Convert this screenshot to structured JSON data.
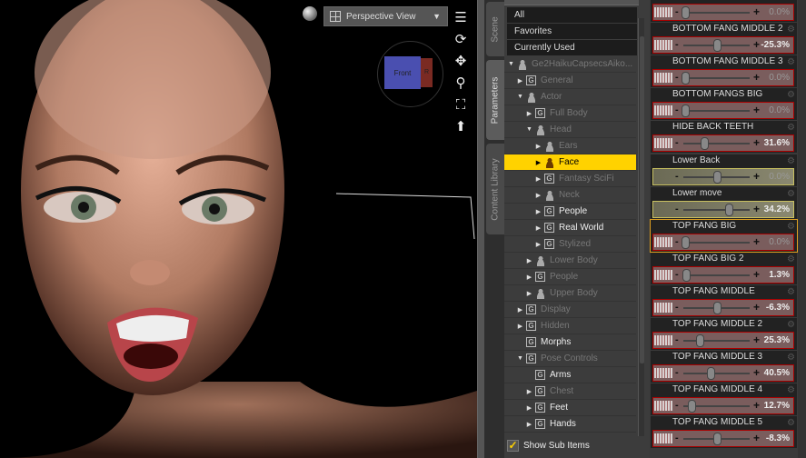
{
  "viewport": {
    "view_label": "Perspective View",
    "cube_front": "Front",
    "cube_side": "R",
    "tools": [
      "menu-icon",
      "orbit-icon",
      "pan-icon",
      "zoom-icon",
      "frame-icon",
      "reset-icon"
    ]
  },
  "side_tabs": [
    {
      "label": "Scene",
      "active": false
    },
    {
      "label": "Parameters",
      "active": true
    },
    {
      "label": "Content Library",
      "active": false
    }
  ],
  "tree": {
    "quick": [
      "All",
      "Favorites",
      "Currently Used"
    ],
    "items": [
      {
        "label": "Ge2HaikuCapsecsAiko...",
        "depth": 0,
        "icon": "figure",
        "exp": "open",
        "on": false
      },
      {
        "label": "General",
        "depth": 1,
        "icon": "group",
        "exp": "closed",
        "on": false
      },
      {
        "label": "Actor",
        "depth": 1,
        "icon": "person",
        "exp": "open",
        "on": false
      },
      {
        "label": "Full Body",
        "depth": 2,
        "icon": "group",
        "exp": "closed",
        "on": false
      },
      {
        "label": "Head",
        "depth": 2,
        "icon": "person",
        "exp": "open",
        "on": false
      },
      {
        "label": "Ears",
        "depth": 3,
        "icon": "person",
        "exp": "closed",
        "on": false
      },
      {
        "label": "Face",
        "depth": 3,
        "icon": "person",
        "exp": "closed",
        "on": true,
        "selected": true
      },
      {
        "label": "Fantasy SciFi",
        "depth": 3,
        "icon": "group",
        "exp": "closed",
        "on": false
      },
      {
        "label": "Neck",
        "depth": 3,
        "icon": "person",
        "exp": "closed",
        "on": false
      },
      {
        "label": "People",
        "depth": 3,
        "icon": "group",
        "exp": "closed",
        "on": true
      },
      {
        "label": "Real World",
        "depth": 3,
        "icon": "group",
        "exp": "closed",
        "on": true
      },
      {
        "label": "Stylized",
        "depth": 3,
        "icon": "group",
        "exp": "closed",
        "on": false
      },
      {
        "label": "Lower Body",
        "depth": 2,
        "icon": "person",
        "exp": "closed",
        "on": false
      },
      {
        "label": "People",
        "depth": 2,
        "icon": "group",
        "exp": "closed",
        "on": false
      },
      {
        "label": "Upper Body",
        "depth": 2,
        "icon": "person",
        "exp": "closed",
        "on": false
      },
      {
        "label": "Display",
        "depth": 1,
        "icon": "group",
        "exp": "closed",
        "on": false
      },
      {
        "label": "Hidden",
        "depth": 1,
        "icon": "group",
        "exp": "closed",
        "on": false
      },
      {
        "label": "Morphs",
        "depth": 1,
        "icon": "group",
        "exp": "none",
        "on": true
      },
      {
        "label": "Pose Controls",
        "depth": 1,
        "icon": "group",
        "exp": "open",
        "on": false
      },
      {
        "label": "Arms",
        "depth": 2,
        "icon": "group",
        "exp": "none",
        "on": true
      },
      {
        "label": "Chest",
        "depth": 2,
        "icon": "group",
        "exp": "closed",
        "on": false
      },
      {
        "label": "Feet",
        "depth": 2,
        "icon": "group",
        "exp": "closed",
        "on": true
      },
      {
        "label": "Hands",
        "depth": 2,
        "icon": "group",
        "exp": "closed",
        "on": true
      }
    ],
    "show_sub_items": {
      "label": "Show Sub Items",
      "checked": true
    }
  },
  "params": [
    {
      "name": "BOTTOM FANG MIDDLE",
      "value": "0.0%",
      "pos": 0.03,
      "style": "red"
    },
    {
      "name": "BOTTOM FANG MIDDLE 2",
      "value": "-25.3%",
      "pos": 0.5,
      "style": "red"
    },
    {
      "name": "BOTTOM FANG MIDDLE 3",
      "value": "0.0%",
      "pos": 0.03,
      "style": "red"
    },
    {
      "name": "BOTTOM FANGS BIG",
      "value": "0.0%",
      "pos": 0.03,
      "style": "red"
    },
    {
      "name": "HIDE BACK TEETH",
      "value": "31.6%",
      "pos": 0.32,
      "style": "red"
    },
    {
      "name": "Lower Back",
      "value": "0.0%",
      "pos": 0.5,
      "style": "yellow"
    },
    {
      "name": "Lower move",
      "value": "34.2%",
      "pos": 0.68,
      "style": "yellow"
    },
    {
      "name": "TOP FANG BIG",
      "value": "0.0%",
      "pos": 0.03,
      "style": "red",
      "highlighted": true
    },
    {
      "name": "TOP FANG BIG 2",
      "value": "1.3%",
      "pos": 0.04,
      "style": "red"
    },
    {
      "name": "TOP FANG MIDDLE",
      "value": "-6.3%",
      "pos": 0.5,
      "style": "red"
    },
    {
      "name": "TOP FANG MIDDLE 2",
      "value": "25.3%",
      "pos": 0.25,
      "style": "red"
    },
    {
      "name": "TOP FANG MIDDLE 3",
      "value": "40.5%",
      "pos": 0.41,
      "style": "red"
    },
    {
      "name": "TOP FANG MIDDLE 4",
      "value": "12.7%",
      "pos": 0.13,
      "style": "red"
    },
    {
      "name": "TOP FANG MIDDLE 5",
      "value": "-8.3%",
      "pos": 0.5,
      "style": "red"
    }
  ]
}
